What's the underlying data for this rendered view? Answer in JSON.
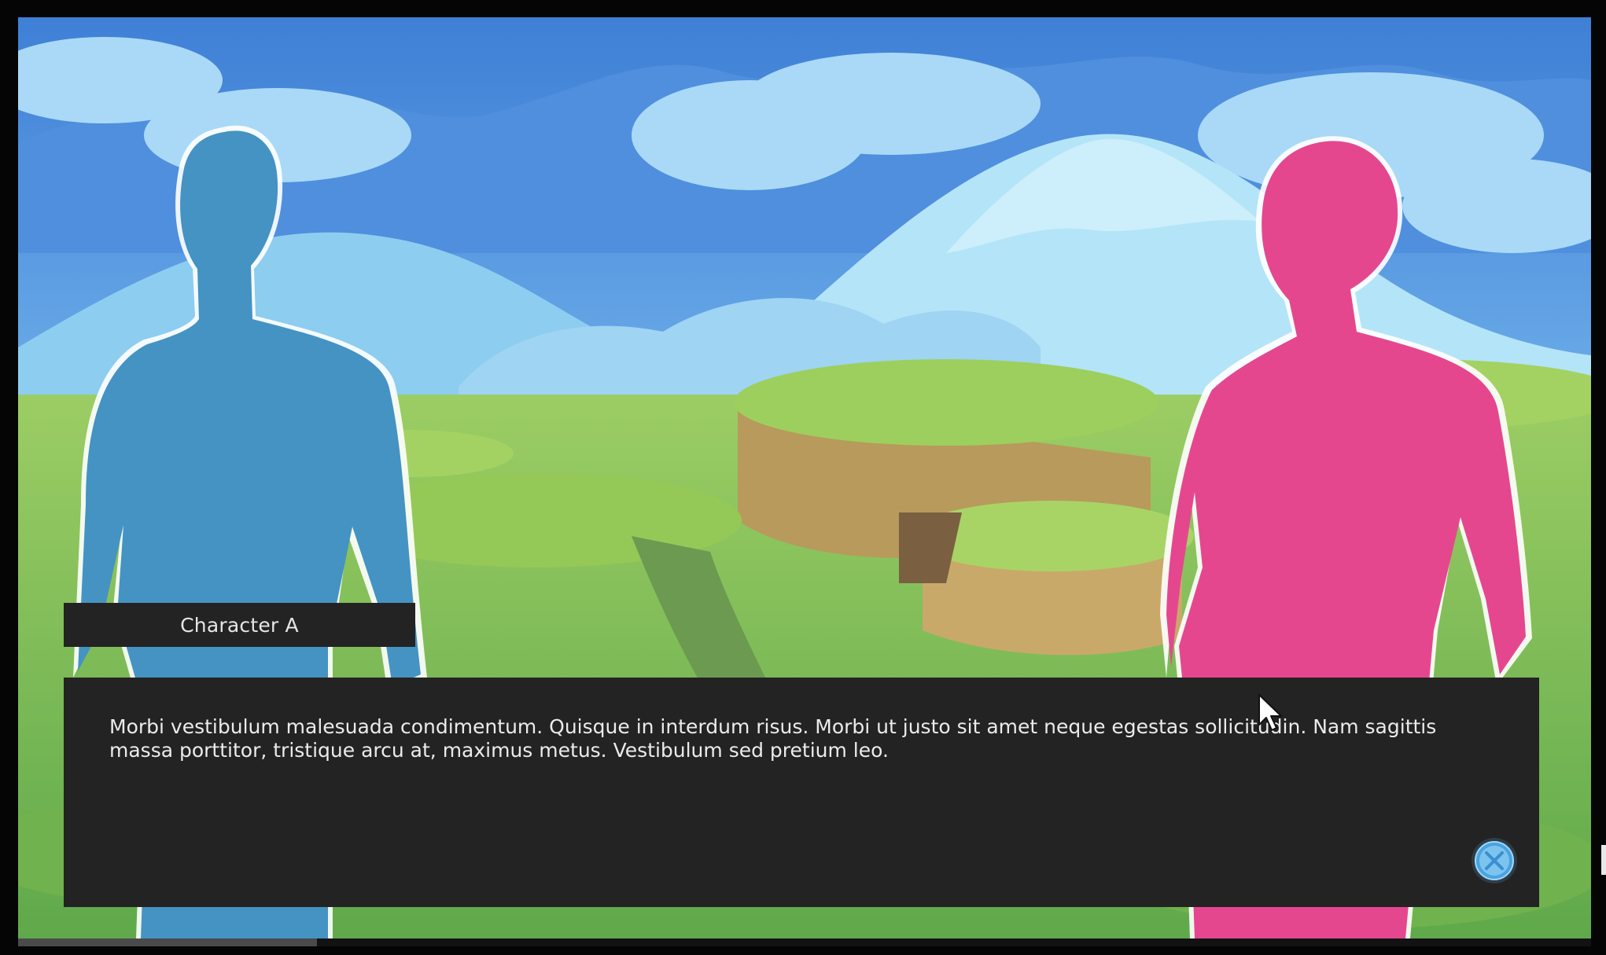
{
  "game": {
    "speaker_name": "Character A",
    "dialogue_text": "Morbi vestibulum malesuada condimentum. Quisque in interdum risus. Morbi ut justo sit amet neque egestas sollicitudin. Nam sagittis massa porttitor, tristique arcu at, maximus metus. Vestibulum sed pretium leo.",
    "advance_icon": "advance-x-icon",
    "progress_fraction": 0.19
  },
  "colors": {
    "character_a": "#4493c3",
    "character_b": "#e5478f",
    "panel": "#232323",
    "sky": "#5b9be6",
    "grass": "#8fc85a"
  }
}
